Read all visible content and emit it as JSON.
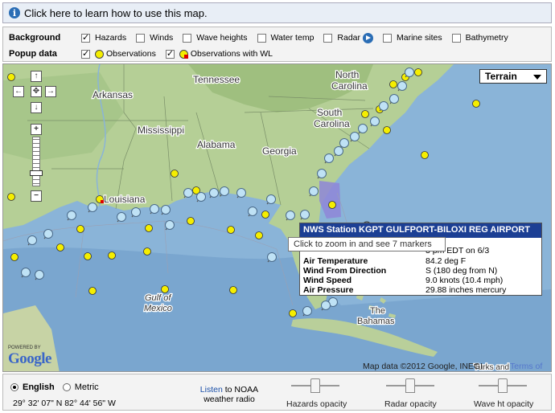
{
  "topbar": {
    "info_icon": "info-icon",
    "text": "Click here to learn how to use this map."
  },
  "background": {
    "title": "Background",
    "options": [
      {
        "label": "Hazards",
        "checked": true
      },
      {
        "label": "Winds",
        "checked": false
      },
      {
        "label": "Wave heights",
        "checked": false
      },
      {
        "label": "Water temp",
        "checked": false
      },
      {
        "label": "Radar",
        "checked": false
      },
      {
        "label": "Marine sites",
        "checked": false
      },
      {
        "label": "Bathymetry",
        "checked": false
      }
    ]
  },
  "popup_data": {
    "title": "Popup data",
    "options": [
      {
        "label": "Observations",
        "checked": true
      },
      {
        "label": "Observations with WL",
        "checked": true
      }
    ]
  },
  "map": {
    "type_selector": "Terrain",
    "labels": {
      "north_carolina_1": "North",
      "north_carolina_2": "Carolina",
      "tennessee": "Tennessee",
      "arkansas": "Arkansas",
      "south_carolina_1": "South",
      "south_carolina_2": "Carolina",
      "mississippi": "Mississippi",
      "alabama": "Alabama",
      "georgia": "Georgia",
      "louisiana": "Louisiana",
      "gulf_1": "Gulf of",
      "gulf_2": "Mexico",
      "the_bahamas_1": "The",
      "the_bahamas_2": "Bahamas",
      "turks_and": "Turks and"
    },
    "attribution": "Map data ©2012 Google, INEGI",
    "terms_link": "Terms of Use",
    "powered_by": "POWERED BY",
    "google_logo": "Google"
  },
  "tooltip": "Click to zoom in and see 7 markers",
  "station_popup": {
    "title": "NWS Station KGPT GULFPORT-BILOXI REG AIRPORT",
    "time_partial": "3 pm EDT on 6/3",
    "rows": [
      {
        "key": "Air Temperature",
        "value": "84.2 deg F"
      },
      {
        "key": "Wind From Direction",
        "value": "S (180 deg from N)"
      },
      {
        "key": "Wind Speed",
        "value": "9.0 knots (10.4 mph)"
      },
      {
        "key": "Air Pressure",
        "value": "29.88 inches mercury"
      }
    ]
  },
  "footer": {
    "units": [
      {
        "label": "English",
        "selected": true
      },
      {
        "label": "Metric",
        "selected": false
      }
    ],
    "coordinates": "29° 32' 07\" N 82° 44' 56\" W",
    "listen_link": "Listen",
    "listen_text": "to NOAA",
    "listen_text2": "weather radio",
    "sliders": [
      {
        "label": "Hazards opacity",
        "value": 0.5
      },
      {
        "label": "Radar opacity",
        "value": 0.5
      },
      {
        "label": "Wave ht opacity",
        "value": 0.5
      }
    ]
  },
  "colors": {
    "land": "#a9c98e",
    "water": "#8ab4d8",
    "marker_yellow": "#f5ee00",
    "hazard_purple": "#8e86d8",
    "popup_header": "#1c3f94",
    "link_blue": "#1a4fa8"
  }
}
